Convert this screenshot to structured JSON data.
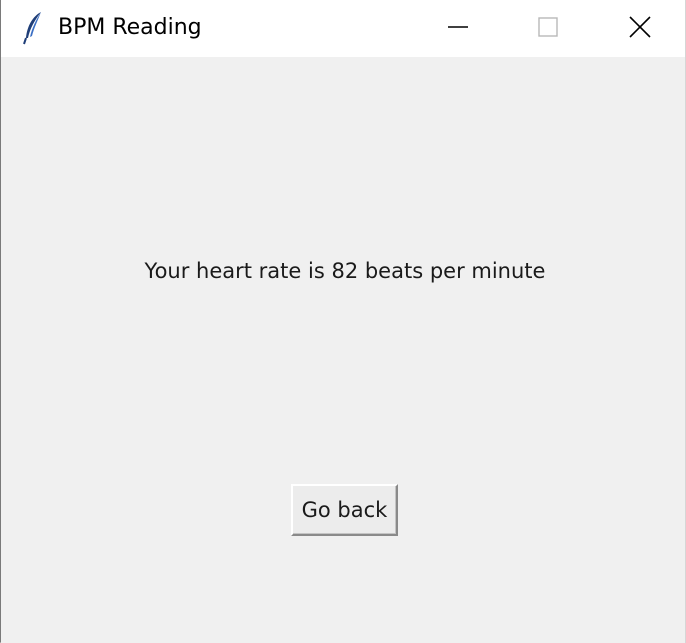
{
  "window": {
    "title": "BPM Reading",
    "icon": "feather-icon"
  },
  "titlebar_controls": {
    "minimize_icon": "minimize-icon",
    "maximize_icon": "maximize-icon",
    "close_icon": "close-icon"
  },
  "main": {
    "message": "Your heart rate is 82 beats per minute",
    "back_button_label": "Go back"
  },
  "colors": {
    "titlebar_bg": "#ffffff",
    "content_bg": "#f0f0f0",
    "text": "#1a1a1a"
  }
}
